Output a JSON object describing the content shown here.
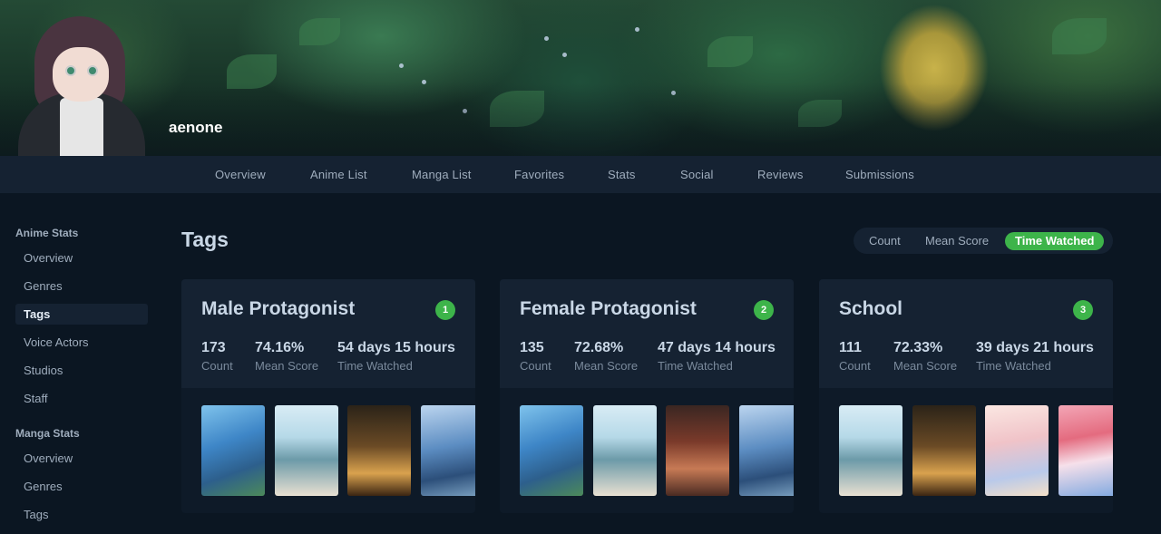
{
  "profile": {
    "username": "aenone"
  },
  "nav": [
    "Overview",
    "Anime List",
    "Manga List",
    "Favorites",
    "Stats",
    "Social",
    "Reviews",
    "Submissions"
  ],
  "sidebar": {
    "anime_heading": "Anime Stats",
    "anime_items": [
      "Overview",
      "Genres",
      "Tags",
      "Voice Actors",
      "Studios",
      "Staff"
    ],
    "manga_heading": "Manga Stats",
    "manga_items": [
      "Overview",
      "Genres",
      "Tags"
    ],
    "active": "Tags"
  },
  "page": {
    "title": "Tags"
  },
  "toggle": {
    "items": [
      "Count",
      "Mean Score",
      "Time Watched"
    ],
    "active": "Time Watched"
  },
  "cards": [
    {
      "title": "Male Protagonist",
      "rank": "1",
      "count": "173",
      "count_label": "Count",
      "mean": "74.16%",
      "mean_label": "Mean Score",
      "time": "54 days 15 hours",
      "time_label": "Time Watched"
    },
    {
      "title": "Female Protagonist",
      "rank": "2",
      "count": "135",
      "count_label": "Count",
      "mean": "72.68%",
      "mean_label": "Mean Score",
      "time": "47 days 14 hours",
      "time_label": "Time Watched"
    },
    {
      "title": "School",
      "rank": "3",
      "count": "111",
      "count_label": "Count",
      "mean": "72.33%",
      "mean_label": "Mean Score",
      "time": "39 days 21 hours",
      "time_label": "Time Watched"
    }
  ],
  "colors": {
    "accent": "#3db44a",
    "background": "#0b1622",
    "panel": "#152232"
  }
}
